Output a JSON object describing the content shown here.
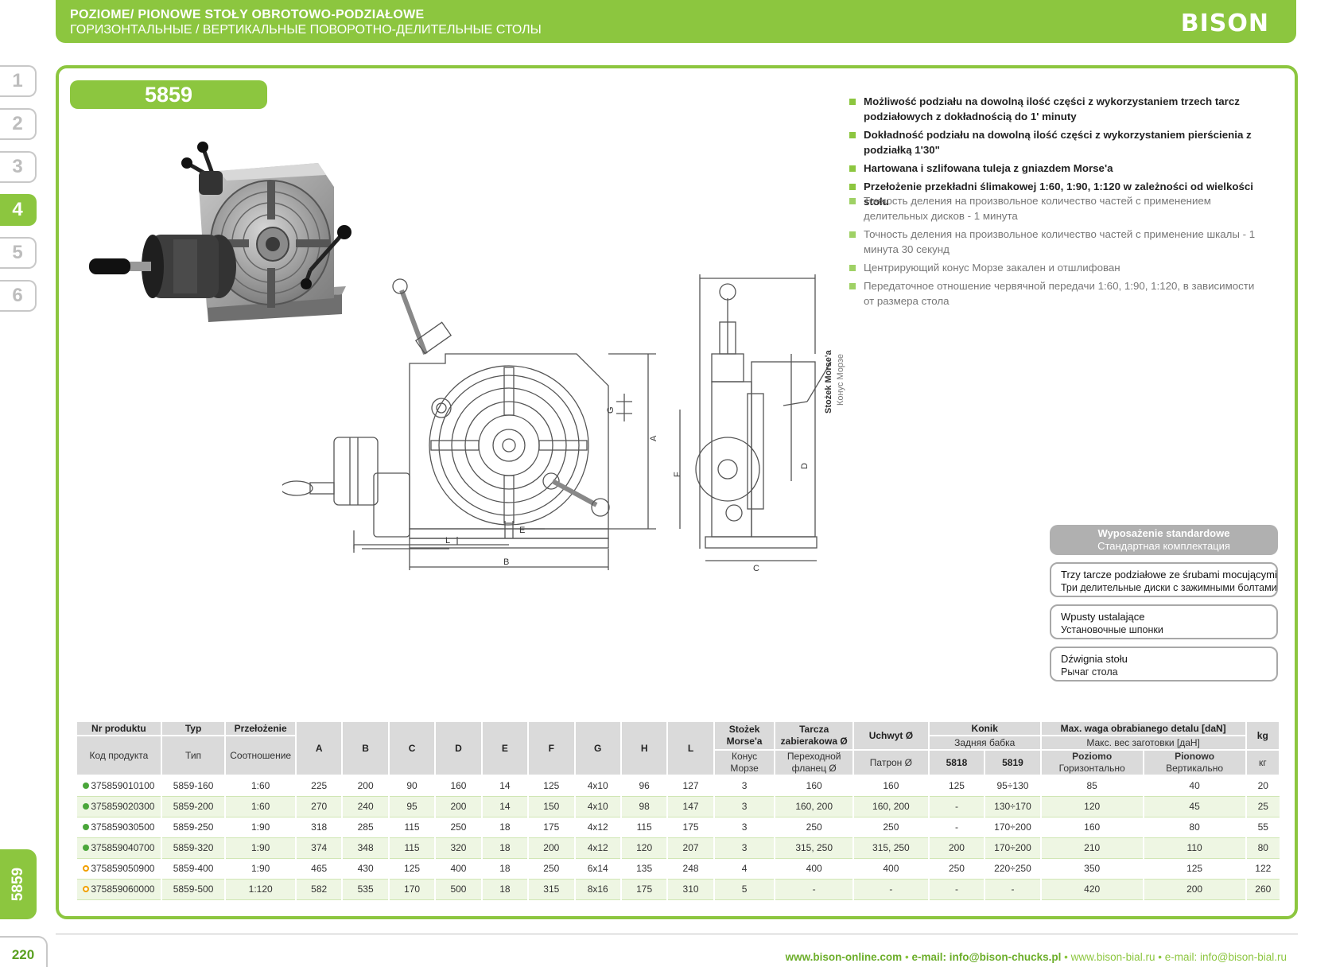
{
  "header": {
    "title_pl": "POZIOME/ PIONOWE STOŁY OBROTOWO-PODZIAŁOWE",
    "title_ru": "ГОРИЗОНТАЛЬНЫЕ / ВЕРТИКАЛЬНЫЕ ПОВОРОТНО-ДЕЛИТЕЛЬНЫЕ СТОЛЫ",
    "logo": "BISON"
  },
  "sidebar": {
    "tabs": [
      "1",
      "2",
      "3",
      "4",
      "5",
      "6"
    ],
    "active_tab": "4",
    "section_code": "5859"
  },
  "product": {
    "code": "5859"
  },
  "features_pl": [
    "Możliwość podziału na dowolną ilość części z wykorzystaniem trzech tarcz podziałowych z dokładnością do 1' minuty",
    "Dokładność podziału na dowolną ilość części z wykorzystaniem pierścienia z podziałką 1'30\"",
    "Hartowana i szlifowana tuleja z gniazdem Morse'a",
    "Przełożenie przekładni ślimakowej 1:60, 1:90, 1:120 w zależności od wielkości stołu"
  ],
  "features_ru": [
    "Точность деления на произвольное количество частей с применением делительных дисков - 1 минута",
    "Точность деления на произвольное количество частей с применение шкалы - 1 минута 30 секунд",
    "Центрирующий конус Морзе закален и отшлифован",
    "Передаточное отношение червячной передачи 1:60, 1:90, 1:120, в зависимости от размера стола"
  ],
  "drawing": {
    "labels": {
      "H": "H",
      "A": "A",
      "F": "F",
      "C": "C",
      "D": "D",
      "E": "E",
      "G": "G",
      "L": "L",
      "B": "B"
    },
    "morse_pl": "Stożek Morse'a",
    "morse_ru": "Конус Морзе"
  },
  "equipment": {
    "header_pl": "Wyposażenie standardowe",
    "header_ru": "Стандартная комплектация",
    "items": [
      {
        "pl": "Trzy tarcze podziałowe ze śrubami mocującymi",
        "ru": "Три делительные диски с зажимными болтами"
      },
      {
        "pl": "Wpusty ustalające",
        "ru": "Установочные шпонки"
      },
      {
        "pl": "Dźwignia stołu",
        "ru": "Рычаг стола"
      }
    ]
  },
  "table": {
    "h": {
      "nr": "Nr produktu",
      "nr_ru": "Код продукта",
      "typ": "Typ",
      "typ_ru": "Тип",
      "prz": "Przełożenie",
      "prz_ru": "Соотношение",
      "A": "A",
      "B": "B",
      "C": "C",
      "D": "D",
      "E": "E",
      "F": "F",
      "G": "G",
      "H": "H",
      "L": "L",
      "morse": "Stożek Morse'a",
      "morse_ru": "Конус Морзе",
      "tarcza": "Tarcza zabierakowa Ø",
      "tarcza_ru": "Переходной фланец Ø",
      "uchwyt": "Uchwyt Ø",
      "uchwyt_ru": "Патрон Ø",
      "konik": "Konik",
      "konik_ru": "Задняя бабка",
      "k5818": "5818",
      "k5819": "5819",
      "waga": "Max. waga obrabianego detalu [daN]",
      "waga_ru": "Макс. вес заготовки [даН]",
      "poz": "Poziomo",
      "poz_ru": "Горизонтально",
      "pion": "Pionowo",
      "pion_ru": "Вертикально",
      "kg": "kg",
      "kg_ru": "кг"
    },
    "rows": [
      [
        "375859010100",
        "5859-160",
        "1:60",
        "225",
        "200",
        "90",
        "160",
        "14",
        "125",
        "4x10",
        "96",
        "127",
        "3",
        "160",
        "160",
        "125",
        "95÷130",
        "85",
        "40",
        "20"
      ],
      [
        "375859020300",
        "5859-200",
        "1:60",
        "270",
        "240",
        "95",
        "200",
        "14",
        "150",
        "4x10",
        "98",
        "147",
        "3",
        "160, 200",
        "160, 200",
        "-",
        "130÷170",
        "120",
        "45",
        "25"
      ],
      [
        "375859030500",
        "5859-250",
        "1:90",
        "318",
        "285",
        "115",
        "250",
        "18",
        "175",
        "4x12",
        "115",
        "175",
        "3",
        "250",
        "250",
        "-",
        "170÷200",
        "160",
        "80",
        "55"
      ],
      [
        "375859040700",
        "5859-320",
        "1:90",
        "374",
        "348",
        "115",
        "320",
        "18",
        "200",
        "4x12",
        "120",
        "207",
        "3",
        "315, 250",
        "315, 250",
        "200",
        "170÷200",
        "210",
        "110",
        "80"
      ],
      [
        "375859050900",
        "5859-400",
        "1:90",
        "465",
        "430",
        "125",
        "400",
        "18",
        "250",
        "6x14",
        "135",
        "248",
        "4",
        "400",
        "400",
        "250",
        "220÷250",
        "350",
        "125",
        "122"
      ],
      [
        "375859060000",
        "5859-500",
        "1:120",
        "582",
        "535",
        "170",
        "500",
        "18",
        "315",
        "8x16",
        "175",
        "310",
        "5",
        "-",
        "-",
        "-",
        "-",
        "420",
        "200",
        "260"
      ]
    ],
    "status": [
      "green",
      "green",
      "green",
      "green",
      "orange",
      "orange"
    ]
  },
  "footer": {
    "page": "220",
    "site": "www.bison-online.com",
    "sep": "•",
    "email": "e-mail: info@bison-chucks.pl",
    "site2": "www.bison-bial.ru",
    "email2": "e-mail: info@bison-bial.ru"
  },
  "colors": {
    "accent": "#8cc63f",
    "green_dot": "#4aa63a",
    "orange_dot": "#f1a000"
  }
}
